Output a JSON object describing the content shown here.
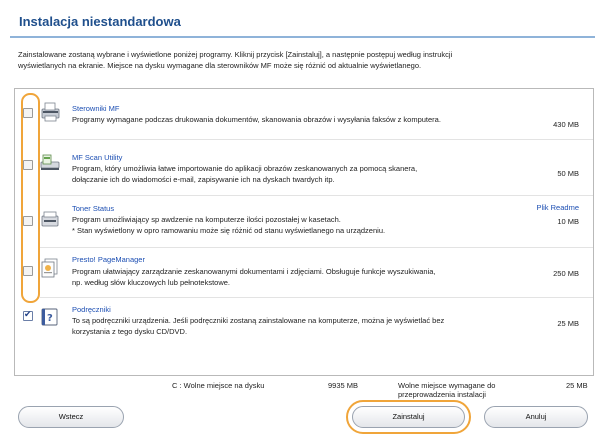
{
  "header": {
    "title": "Instalacja niestandardowa"
  },
  "instructions": [
    "Zainstalowane zostaną wybrane i wyświetlone poniżej programy. Kliknij przycisk [Zainstaluj], a następnie postępuj według instrukcji",
    "wyświetlanych na ekranie. Miejsce na dysku wymagane dla sterowników MF może się różnić od aktualnie wyświetlanego."
  ],
  "items": [
    {
      "name": "Sterowniki MF",
      "desc1": "Programy wymagane podczas drukowania dokumentów, skanowania obrazów i wysyłania faksów z komputera.",
      "desc2": "",
      "size": "430 MB",
      "checked": false,
      "icon": "printer-icon"
    },
    {
      "name": "MF Scan Utility",
      "desc1": "Program, który umożliwia łatwe importowanie do aplikacji obrazów zeskanowanych za pomocą skanera,",
      "desc2": "dołączanie ich do wiadomości e-mail, zapisywanie ich na dyskach twardych itp.",
      "size": "50 MB",
      "checked": false,
      "icon": "scanner-icon"
    },
    {
      "name": "Toner Status",
      "desc1": "Program umożliwiający sp    awdzenie na komputerze ilości pozostałej w kasetach.",
      "desc2": "* Stan wyświetlony w opro  ramowaniu może się różnić od stanu wyświetlanego na urządzeniu.",
      "size": "10 MB",
      "readme": "Plik Readme",
      "checked": false,
      "icon": "toner-icon"
    },
    {
      "name": "Presto! PageManager",
      "desc1": "Program ułatwiający zarządzanie zeskanowanymi dokumentami i zdjęciami. Obsługuje funkcje wyszukiwania,",
      "desc2": "np. według słów kluczowych lub pełnotekstowe.",
      "size": "250 MB",
      "checked": false,
      "icon": "documents-icon"
    },
    {
      "name": "Podręczniki",
      "desc1": "To są podręczniki urządzenia. Jeśli podręczniki zostaną zainstalowane na komputerze, można je wyświetlać bez",
      "desc2": "korzystania z tego dysku CD/DVD.",
      "size": "25 MB",
      "checked": true,
      "icon": "manual-icon"
    }
  ],
  "footer": {
    "free_label": "C : Wolne miejsce na dysku",
    "free_value": "9935 MB",
    "required_label_1": "Wolne miejsce wymagane do",
    "required_label_2": "przeprowadzenia instalacji",
    "required_value": "25 MB"
  },
  "buttons": {
    "back": "Wstecz",
    "install": "Zainstaluj",
    "cancel": "Anuluj"
  },
  "colors": {
    "accent": "#1f4f8c",
    "highlight": "#f0a53a",
    "link": "#1d4fb3"
  }
}
